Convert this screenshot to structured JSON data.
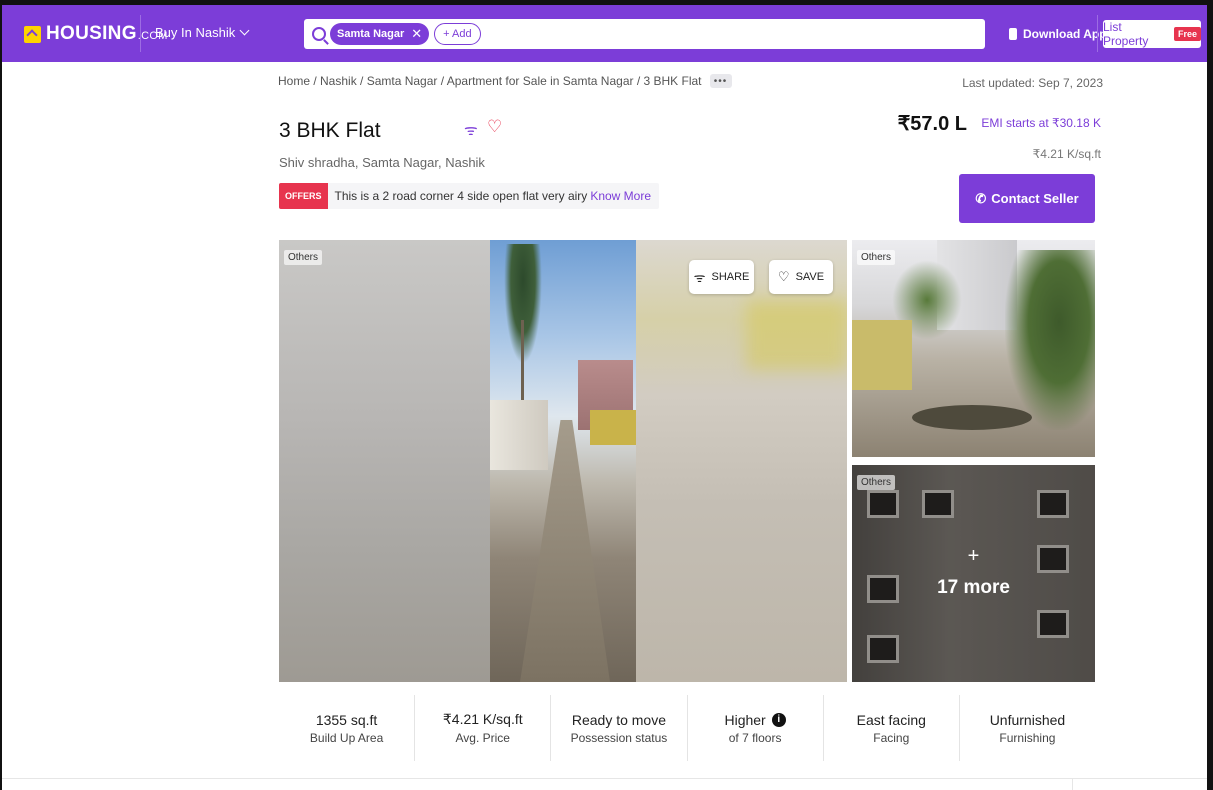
{
  "header": {
    "logo_text": "HOUSING",
    "logo_suffix": ".COM",
    "city_selector": "Buy In Nashik",
    "search_chip": "Samta Nagar",
    "search_add": "+ Add",
    "download_app": "Download App",
    "list_property": "List Property",
    "free_badge": "Free",
    "brand_color": "#7c3dd8"
  },
  "breadcrumb": "Home / Nashik / Samta Nagar / Apartment for Sale in Samta Nagar / 3 BHK Flat",
  "breadcrumb_more": "•••",
  "last_updated": "Last updated: Sep 7, 2023",
  "listing": {
    "title": "3 BHK Flat",
    "address": "Shiv shradha, Samta Nagar, Nashik",
    "offer_tag": "OFFERS",
    "offer_text": "This is a 2 road corner 4 side open flat very airy",
    "offer_link": "Know More",
    "price": "₹57.0 L",
    "emi": "EMI starts at ₹30.18 K",
    "price_per_sqft": "₹4.21 K/sq.ft",
    "contact_button": "Contact Seller"
  },
  "gallery": {
    "main_tag": "Others",
    "share_label": "SHARE",
    "save_label": "SAVE",
    "side1_tag": "Others",
    "side2_tag": "Others",
    "more_plus": "+",
    "more_label": "17 more"
  },
  "stats": [
    {
      "value": "1355 sq.ft",
      "label": "Build Up Area"
    },
    {
      "value": "₹4.21 K/sq.ft",
      "label": "Avg. Price"
    },
    {
      "value": "Ready to move",
      "label": "Possession status"
    },
    {
      "value": "Higher",
      "label": "of 7 floors"
    },
    {
      "value": "East facing",
      "label": "Facing"
    },
    {
      "value": "Unfurnished",
      "label": "Furnishing"
    }
  ],
  "icons": {
    "share": "share-icon",
    "heart": "heart-icon",
    "search": "search-icon",
    "info": "i"
  }
}
